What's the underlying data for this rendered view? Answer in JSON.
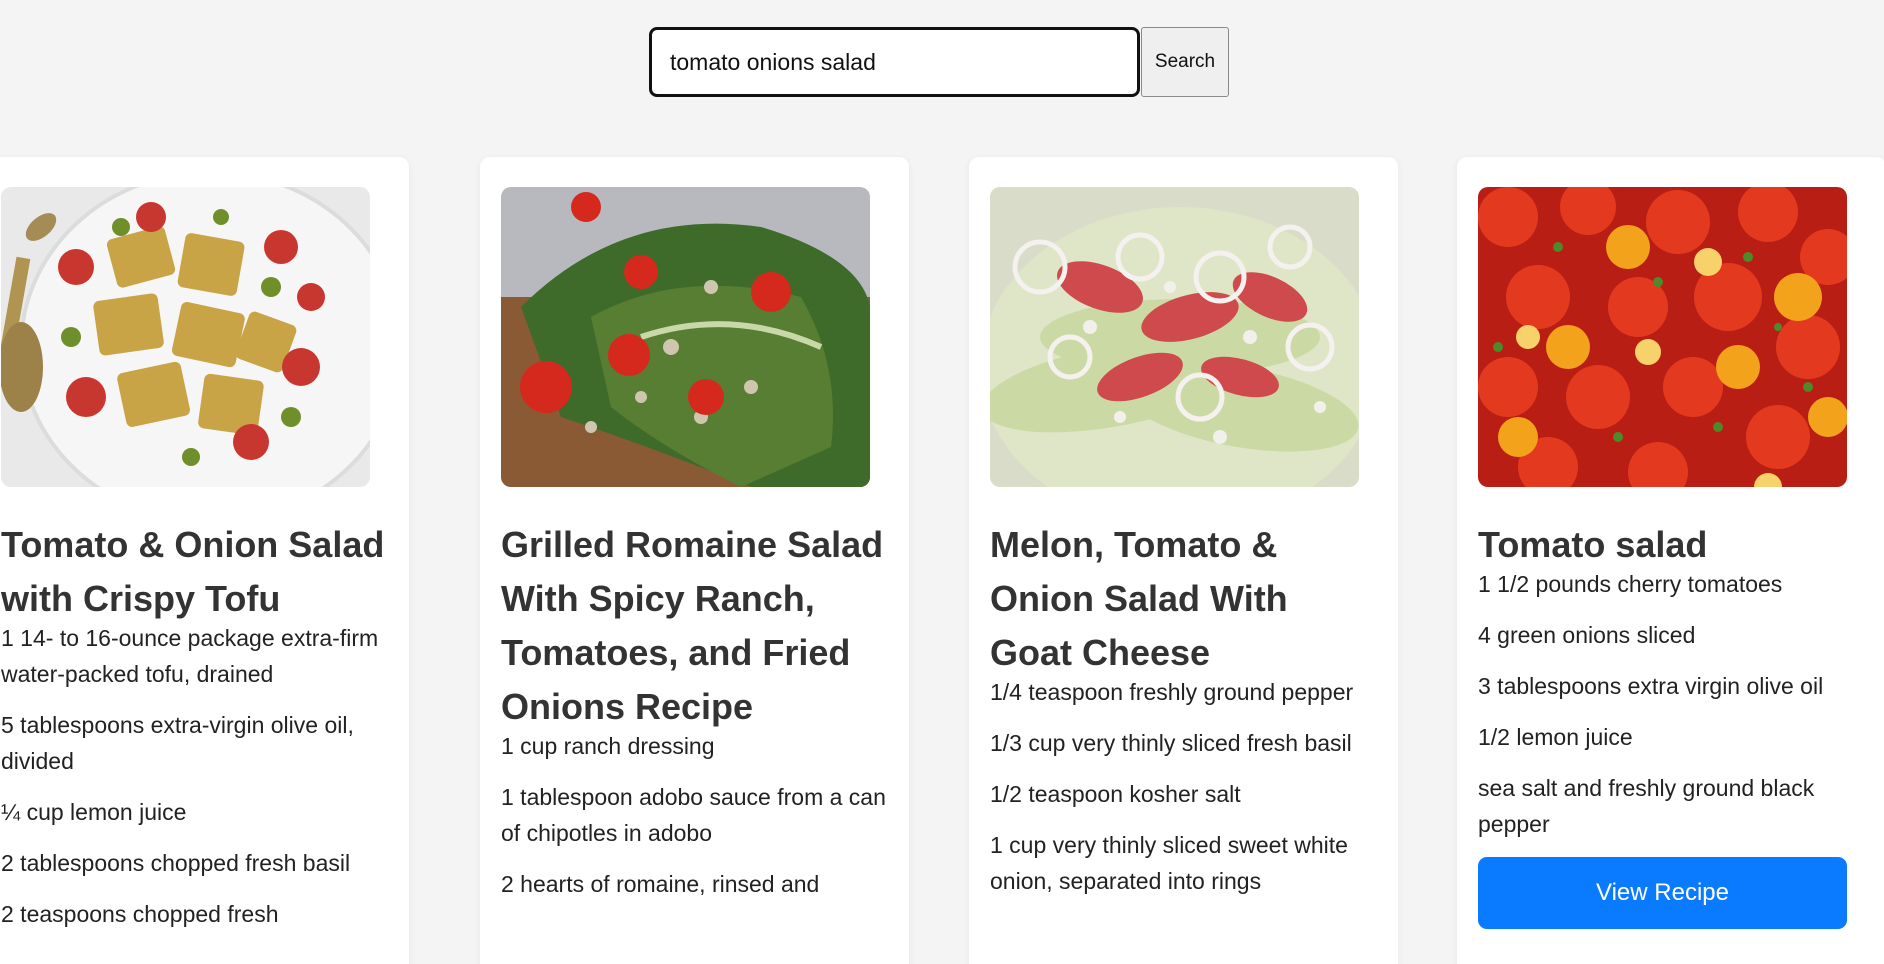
{
  "search": {
    "value": "tomato onions salad",
    "button_label": "Search"
  },
  "recipes": [
    {
      "title": "Tomato & Onion Salad with Crispy Tofu",
      "image": "tofu-tomato-salad-photo",
      "ingredients": [
        "1 14- to 16-ounce package extra-firm water-packed tofu, drained",
        "5 tablespoons extra-virgin olive oil, divided",
        "¼ cup lemon juice",
        "2 tablespoons chopped fresh basil",
        "2 teaspoons chopped fresh"
      ]
    },
    {
      "title": "Grilled Romaine Salad With Spicy Ranch, Tomatoes, and Fried Onions Recipe",
      "image": "grilled-romaine-photo",
      "ingredients": [
        "1 cup ranch dressing",
        "1 tablespoon adobo sauce from a can of chipotles in adobo",
        "2 hearts of romaine, rinsed and"
      ]
    },
    {
      "title": "Melon, Tomato & Onion Salad With Goat Cheese",
      "image": "melon-tomato-salad-photo",
      "ingredients": [
        "1/4 teaspoon freshly ground pepper",
        "1/3 cup very thinly sliced fresh basil",
        "1/2 teaspoon kosher salt",
        "1 cup very thinly sliced sweet white onion, separated into rings"
      ]
    },
    {
      "title": "Tomato salad",
      "image": "cherry-tomato-salad-photo",
      "ingredients": [
        "1 1/2 pounds cherry tomatoes",
        "4 green onions sliced",
        "3 tablespoons extra virgin olive oil",
        "1/2 lemon juice",
        "sea salt and freshly ground black pepper"
      ],
      "button_label": "View Recipe"
    }
  ],
  "colors": {
    "page_bg": "#f4f4f4",
    "button_blue": "#0a7bff"
  }
}
